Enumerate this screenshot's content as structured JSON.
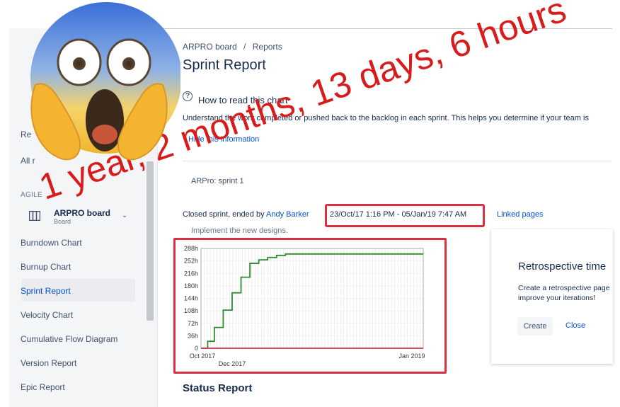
{
  "breadcrumb": {
    "board": "ARPRO board",
    "separator": "/",
    "page": "Reports"
  },
  "page_title": "Sprint Report",
  "help": {
    "icon": "question-circle-icon",
    "title": "How to read this chart",
    "text": "Understand the work completed or pushed back to the backlog in each sprint. This helps you determine if your team is",
    "hide_link": "Hide this information"
  },
  "sprint": {
    "selector": "ARPro: sprint 1",
    "closed_prefix": "Closed sprint, ended by",
    "ended_by": "Andy Barker",
    "dates": "23/Oct/17 1:16 PM - 05/Jan/19 7:47 AM",
    "linked_pages": "Linked pages",
    "goal": "Implement the new designs."
  },
  "sidebar": {
    "partial_items": [
      {
        "label": "Re"
      },
      {
        "label": "All r"
      }
    ],
    "section_label": "AGILE",
    "board": {
      "icon": "board-icon",
      "name": "ARPRO board",
      "subtitle": "Board",
      "chevron": "chevron-down-icon"
    },
    "items": [
      {
        "label": "Burndown Chart"
      },
      {
        "label": "Burnup Chart"
      },
      {
        "label": "Sprint Report",
        "active": true
      },
      {
        "label": "Velocity Chart"
      },
      {
        "label": "Cumulative Flow Diagram"
      },
      {
        "label": "Version Report"
      },
      {
        "label": "Epic Report"
      }
    ]
  },
  "chart_data": {
    "type": "line",
    "title": "",
    "xlabel": "",
    "ylabel": "",
    "y_ticks": [
      "0",
      "36h",
      "72h",
      "108h",
      "144h",
      "180h",
      "216h",
      "252h",
      "288h"
    ],
    "ylim": [
      0,
      288
    ],
    "x_ticks": [
      "Oct 2017",
      "Dec 2017",
      "Jan 2019"
    ],
    "grid": true,
    "series": [
      {
        "color": "#2e8b2e",
        "points": [
          [
            0,
            0
          ],
          [
            3,
            20
          ],
          [
            6,
            60
          ],
          [
            10,
            110
          ],
          [
            14,
            160
          ],
          [
            18,
            205
          ],
          [
            22,
            245
          ],
          [
            26,
            255
          ],
          [
            30,
            262
          ],
          [
            34,
            268
          ],
          [
            38,
            272
          ],
          [
            100,
            272
          ]
        ]
      },
      {
        "color": "#d93141",
        "points": [
          [
            0,
            0
          ],
          [
            100,
            0
          ]
        ]
      }
    ]
  },
  "retrospective": {
    "title": "Retrospective time",
    "text_line1": "Create a retrospective page",
    "text_line2": "improve your iterations!",
    "create": "Create",
    "close": "Close"
  },
  "status_report": "Status Report",
  "overlay_caption": "1 year, 2 months, 13 days, 6 hours",
  "emoji": "screaming-face-emoji",
  "colors": {
    "highlight_red": "#d93141",
    "link_blue": "#0052cc",
    "line_green": "#2e8b2e"
  }
}
